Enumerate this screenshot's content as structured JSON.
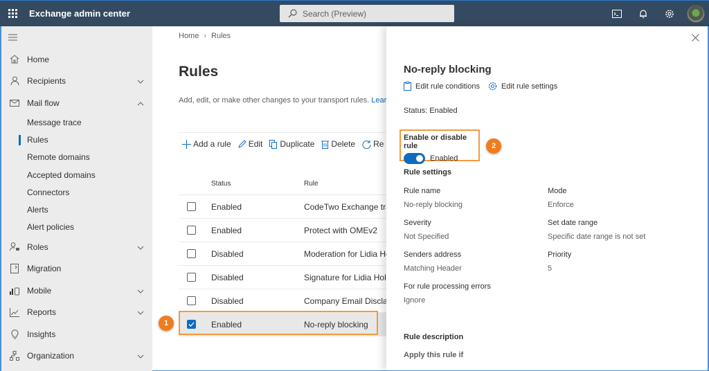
{
  "header": {
    "app_title": "Exchange admin center",
    "search_placeholder": "Search (Preview)",
    "icons": [
      "waffle-icon",
      "terminal-icon",
      "bell-icon",
      "gear-icon",
      "avatar"
    ]
  },
  "sidebar": {
    "items": [
      {
        "label": "Home",
        "icon": "home-icon",
        "chevron": ""
      },
      {
        "label": "Recipients",
        "icon": "person-icon",
        "chevron": "down"
      },
      {
        "label": "Mail flow",
        "icon": "mail-icon",
        "chevron": "up"
      },
      {
        "label": "Roles",
        "icon": "roles-icon",
        "chevron": "down"
      },
      {
        "label": "Migration",
        "icon": "migration-icon",
        "chevron": ""
      },
      {
        "label": "Mobile",
        "icon": "mobile-icon",
        "chevron": "down"
      },
      {
        "label": "Reports",
        "icon": "reports-icon",
        "chevron": "down"
      },
      {
        "label": "Insights",
        "icon": "lightbulb-icon",
        "chevron": ""
      },
      {
        "label": "Organization",
        "icon": "organization-icon",
        "chevron": "down"
      }
    ],
    "mail_flow_sub": [
      {
        "label": "Message trace",
        "active": false
      },
      {
        "label": "Rules",
        "active": true
      },
      {
        "label": "Remote domains",
        "active": false
      },
      {
        "label": "Accepted domains",
        "active": false
      },
      {
        "label": "Connectors",
        "active": false
      },
      {
        "label": "Alerts",
        "active": false
      },
      {
        "label": "Alert policies",
        "active": false
      }
    ]
  },
  "main": {
    "breadcrumb": [
      "Home",
      "Rules"
    ],
    "title": "Rules",
    "description": "Add, edit, or make other changes to your transport rules.",
    "learn_link": "Lear",
    "commands": [
      {
        "label": "Add a rule",
        "icon": "plus-icon"
      },
      {
        "label": "Edit",
        "icon": "pencil-icon"
      },
      {
        "label": "Duplicate",
        "icon": "duplicate-icon"
      },
      {
        "label": "Delete",
        "icon": "trash-icon"
      },
      {
        "label": "Re",
        "icon": "refresh-icon"
      }
    ],
    "table": {
      "headers": {
        "status": "Status",
        "rule": "Rule"
      },
      "rows": [
        {
          "status": "Enabled",
          "rule": "CodeTwo Exchange tran",
          "checked": false
        },
        {
          "status": "Enabled",
          "rule": "Protect with OMEv2",
          "checked": false
        },
        {
          "status": "Disabled",
          "rule": "Moderation for Lidia Ho",
          "checked": false
        },
        {
          "status": "Disabled",
          "rule": "Signature for Lidia Hollo",
          "checked": false
        },
        {
          "status": "Disabled",
          "rule": "Company Email Disclaim",
          "checked": false
        },
        {
          "status": "Enabled",
          "rule": "No-reply blocking",
          "checked": true
        }
      ]
    }
  },
  "annotations": {
    "step1": "1",
    "step2": "2",
    "accent": "#f07c1c"
  },
  "panel": {
    "title": "No-reply blocking",
    "actions": {
      "edit_conditions": "Edit rule conditions",
      "edit_settings": "Edit rule settings"
    },
    "status_line": "Status: Enabled",
    "toggle": {
      "label": "Enable or disable rule",
      "state_text": "Enabled",
      "on": true
    },
    "rule_settings_title": "Rule settings",
    "fields": {
      "rule_name": {
        "label": "Rule name",
        "value": "No-reply blocking"
      },
      "mode": {
        "label": "Mode",
        "value": "Enforce"
      },
      "severity": {
        "label": "Severity",
        "value": "Not Specified"
      },
      "date_range": {
        "label": "Set date range",
        "value": "Specific date range is not set"
      },
      "senders": {
        "label": "Senders address",
        "value": "Matching Header"
      },
      "priority": {
        "label": "Priority",
        "value": "5"
      },
      "errors": {
        "label": "For rule processing errors",
        "value": "Ignore"
      }
    },
    "rule_description_title": "Rule description",
    "apply_if": "Apply this rule if"
  },
  "colors": {
    "topbar": "#344a60",
    "accent_blue": "#0f6cbd",
    "highlight_orange": "#f59a3a"
  }
}
